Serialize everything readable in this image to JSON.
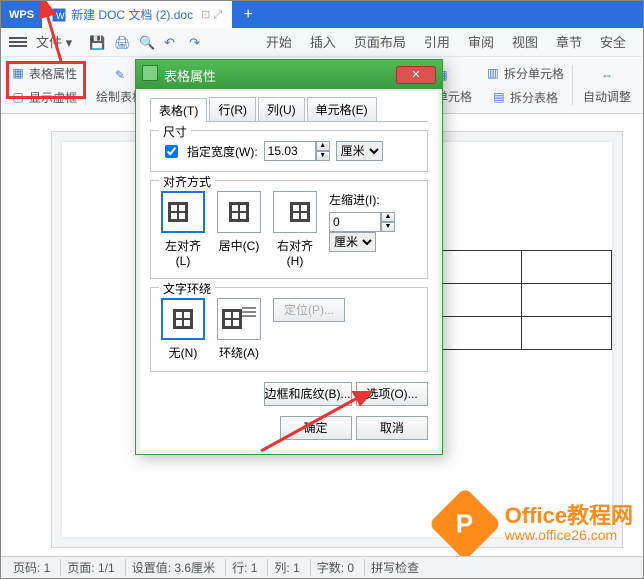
{
  "titlebar": {
    "app": "WPS",
    "doc_tab": "新建 DOC 文档 (2).doc",
    "newtab": "+"
  },
  "menubar": {
    "file": "文件",
    "items": [
      "开始",
      "插入",
      "页面布局",
      "引用",
      "审阅",
      "视图",
      "章节",
      "安全"
    ]
  },
  "ribbon": {
    "table_props": "表格属性",
    "show_frame": "显示虚框",
    "draw_table": "绘制表格",
    "merge_cells": "合并单元格",
    "split_cells": "拆分单元格",
    "split_table": "拆分表格",
    "auto_adjust": "自动调整"
  },
  "dialog": {
    "title": "表格属性",
    "tabs": {
      "table": "表格(T)",
      "row": "行(R)",
      "col": "列(U)",
      "cell": "单元格(E)"
    },
    "size": {
      "legend": "尺寸",
      "width_label": "指定宽度(W):",
      "width_value": "15.03",
      "unit": "厘米"
    },
    "align": {
      "legend": "对齐方式",
      "left": "左对齐(L)",
      "center": "居中(C)",
      "right": "右对齐(H)",
      "indent_label": "左缩进(I):",
      "indent_value": "0",
      "indent_unit": "厘米"
    },
    "wrap": {
      "legend": "文字环绕",
      "none": "无(N)",
      "around": "环绕(A)",
      "position": "定位(P)..."
    },
    "buttons": {
      "border": "边框和底纹(B)...",
      "options": "选项(O)...",
      "ok": "确定",
      "cancel": "取消"
    }
  },
  "statusbar": {
    "page": "页码: 1",
    "pages": "页面: 1/1",
    "setwidth": "设置值: 3.6厘米",
    "row": "行: 1",
    "col": "列: 1",
    "chars": "字数: 0",
    "spell": "拼写检查"
  },
  "brand": {
    "title": "Office教程网",
    "url": "www.office26.com"
  }
}
